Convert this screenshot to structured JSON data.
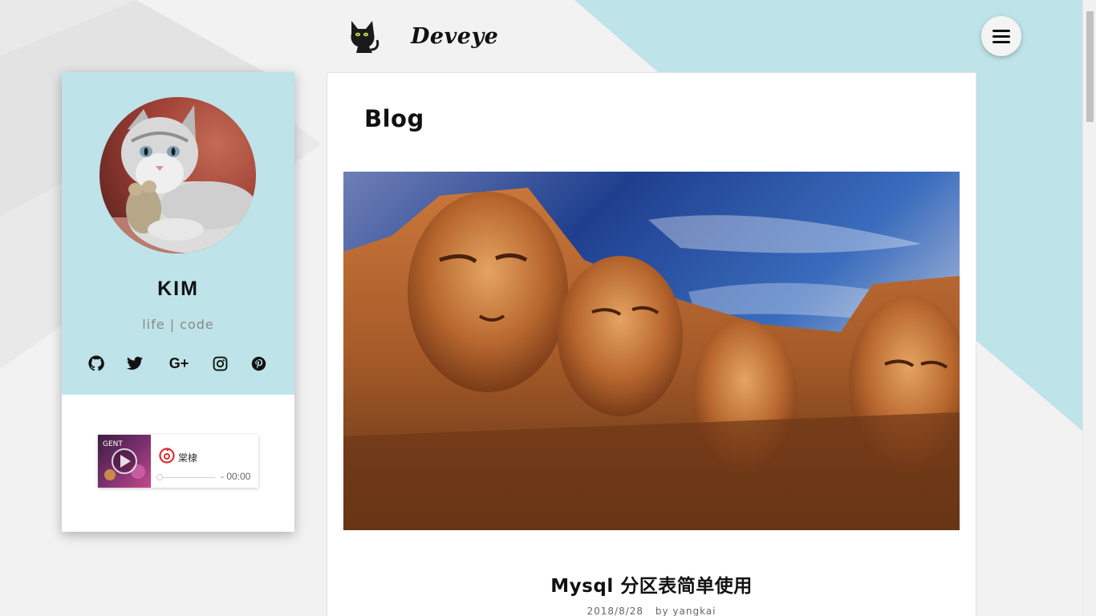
{
  "header": {
    "brand_name": "Deveye",
    "logo_icon": "black-cat-icon",
    "menu_icon": "hamburger-menu-icon"
  },
  "profile": {
    "name": "KIM",
    "bio": "life | code",
    "social": [
      {
        "icon": "github-icon"
      },
      {
        "icon": "twitter-icon"
      },
      {
        "icon": "google-plus-icon",
        "label": "G+"
      },
      {
        "icon": "instagram-icon"
      },
      {
        "icon": "pinterest-icon"
      }
    ]
  },
  "player": {
    "song_title": "棠棣",
    "time": "- 00:00",
    "progress": 0,
    "source_icon": "netease-music-icon",
    "play_icon": "play-icon"
  },
  "main": {
    "page_title": "Blog",
    "post": {
      "title": "Mysql 分区表简单使用",
      "date": "2018/8/28",
      "author": "by yangkai"
    }
  },
  "colors": {
    "accent": "#bee3e8",
    "background": "#f2f2f2"
  }
}
